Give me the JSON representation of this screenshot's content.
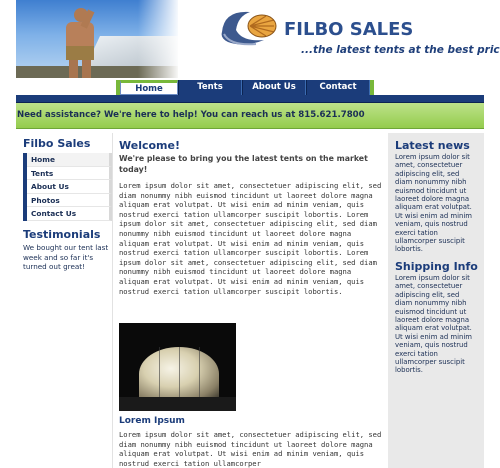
{
  "brand": {
    "name": "FILBO SALES",
    "tagline": "...the latest tents at the best prices"
  },
  "nav": {
    "items": [
      {
        "label": "Home"
      },
      {
        "label": "Tents"
      },
      {
        "label": "About Us"
      },
      {
        "label": "Contact"
      }
    ],
    "active_index": 0
  },
  "banner": {
    "text": "Need assistance? We're here to help! You can reach us at 815.621.7800"
  },
  "left_sidebar": {
    "company_title": "Filbo Sales",
    "menu": [
      {
        "label": "Home"
      },
      {
        "label": "Tents"
      },
      {
        "label": "About Us"
      },
      {
        "label": "Photos"
      },
      {
        "label": "Contact Us"
      }
    ],
    "testimonials_title": "Testimonials",
    "testimonial_text": "We bought our tent last week and so far it's turned out great!"
  },
  "main": {
    "welcome": "Welcome!",
    "subhead": "We're please to bring you the latest tents on the market today!",
    "paragraph1": "Lorem ipsum dolor sit amet, consectetuer adipiscing elit, sed diam nonummy nibh euismod tincidunt ut laoreet dolore magna aliquam erat volutpat. Ut wisi enim ad minim veniam, quis nostrud exerci tation ullamcorper suscipit lobortis. Lorem ipsum dolor sit amet, consectetuer adipiscing elit, sed diam nonummy nibh euismod tincidunt ut laoreet dolore magna aliquam erat volutpat. Ut wisi enim ad minim veniam, quis nostrud exerci tation ullamcorper suscipit lobortis. Lorem ipsum dolor sit amet, consectetuer adipiscing elit, sed diam nonummy nibh euismod tincidunt ut laoreet dolore magna aliquam erat volutpat. Ut wisi enim ad minim veniam, quis nostrud exerci tation ullamcorper suscipit lobortis.",
    "lorem_heading": "Lorem Ipsum",
    "paragraph2": "Lorem ipsum dolor sit amet, consectetuer adipiscing elit, sed diam nonummy nibh euismod tincidunt ut laoreet dolore magna aliquam erat volutpat. Ut wisi enim ad minim veniam, quis nostrud exerci tation ullamcorper"
  },
  "right_sidebar": {
    "news_title": "Latest news",
    "news_text": "Lorem ipsum dolor sit amet, consectetuer adipiscing elit, sed diam nonummy nibh euismod tincidunt ut laoreet dolore magna aliquam erat volutpat. Ut wisi enim ad minim veniam, quis nostrud exerci tation ullamcorper suscipit lobortis.",
    "shipping_title": "Shipping Info",
    "shipping_text": "Lorem ipsum dolor sit amet, consectetuer adipiscing elit, sed diam nonummy nibh euismod tincidunt ut laoreet dolore magna aliquam erat volutpat. Ut wisi enim ad minim veniam, quis nostrud exerci tation ullamcorper suscipit lobortis."
  },
  "colors": {
    "navy": "#1b3c7a",
    "green": "#94cc4d",
    "sidebar_grey": "#e9e9e9"
  },
  "icons": {
    "logo": "shell-swoosh-logo-icon"
  }
}
